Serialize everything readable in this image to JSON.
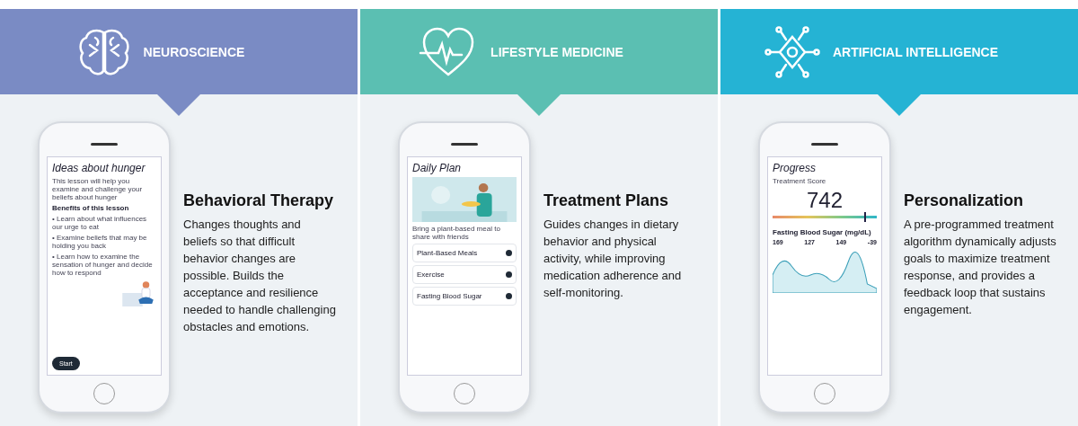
{
  "columns": [
    {
      "header": {
        "label": "NEUROSCIENCE",
        "color": "#7a8bc4"
      },
      "title": "Behavioral Therapy",
      "description": "Changes thoughts and beliefs so that difficult behavior changes are possible. Builds the acceptance and resilience needed to handle challenging obstacles and emotions.",
      "phone": {
        "kind": "lesson",
        "title": "Ideas about hunger",
        "intro": "This lesson will help you examine and challenge your beliefs about hunger",
        "heading": "Benefits of this lesson",
        "bullets": [
          "• Learn about what influences our urge to eat",
          "• Examine beliefs that may be holding you back",
          "• Learn how to examine the sensation of hunger and decide how to respond"
        ],
        "button": "Start"
      }
    },
    {
      "header": {
        "label": "LIFESTYLE MEDICINE",
        "color": "#5bbfb2"
      },
      "title": "Treatment Plans",
      "description": "Guides changes in dietary behavior and physical activity, while improving medication adherence and self-monitoring.",
      "phone": {
        "kind": "plan",
        "title": "Daily Plan",
        "card": "Bring a plant-based meal to share with friends",
        "items": [
          "Plant-Based Meals",
          "Exercise",
          "Fasting Blood Sugar"
        ]
      }
    },
    {
      "header": {
        "label": "ARTIFICIAL INTELLIGENCE",
        "color": "#25b3d4"
      },
      "title": "Personalization",
      "description": "A pre-programmed treatment algorithm dynamically adjusts goals to maximize treatment response, and provides a feedback loop that sustains engagement.",
      "phone": {
        "kind": "progress",
        "title": "Progress",
        "score_label": "Treatment Score",
        "score": "742",
        "level": 0.88,
        "metric": "Fasting Blood Sugar (mg/dL)",
        "stats": [
          "169",
          "127",
          "149",
          "-39"
        ]
      }
    }
  ]
}
